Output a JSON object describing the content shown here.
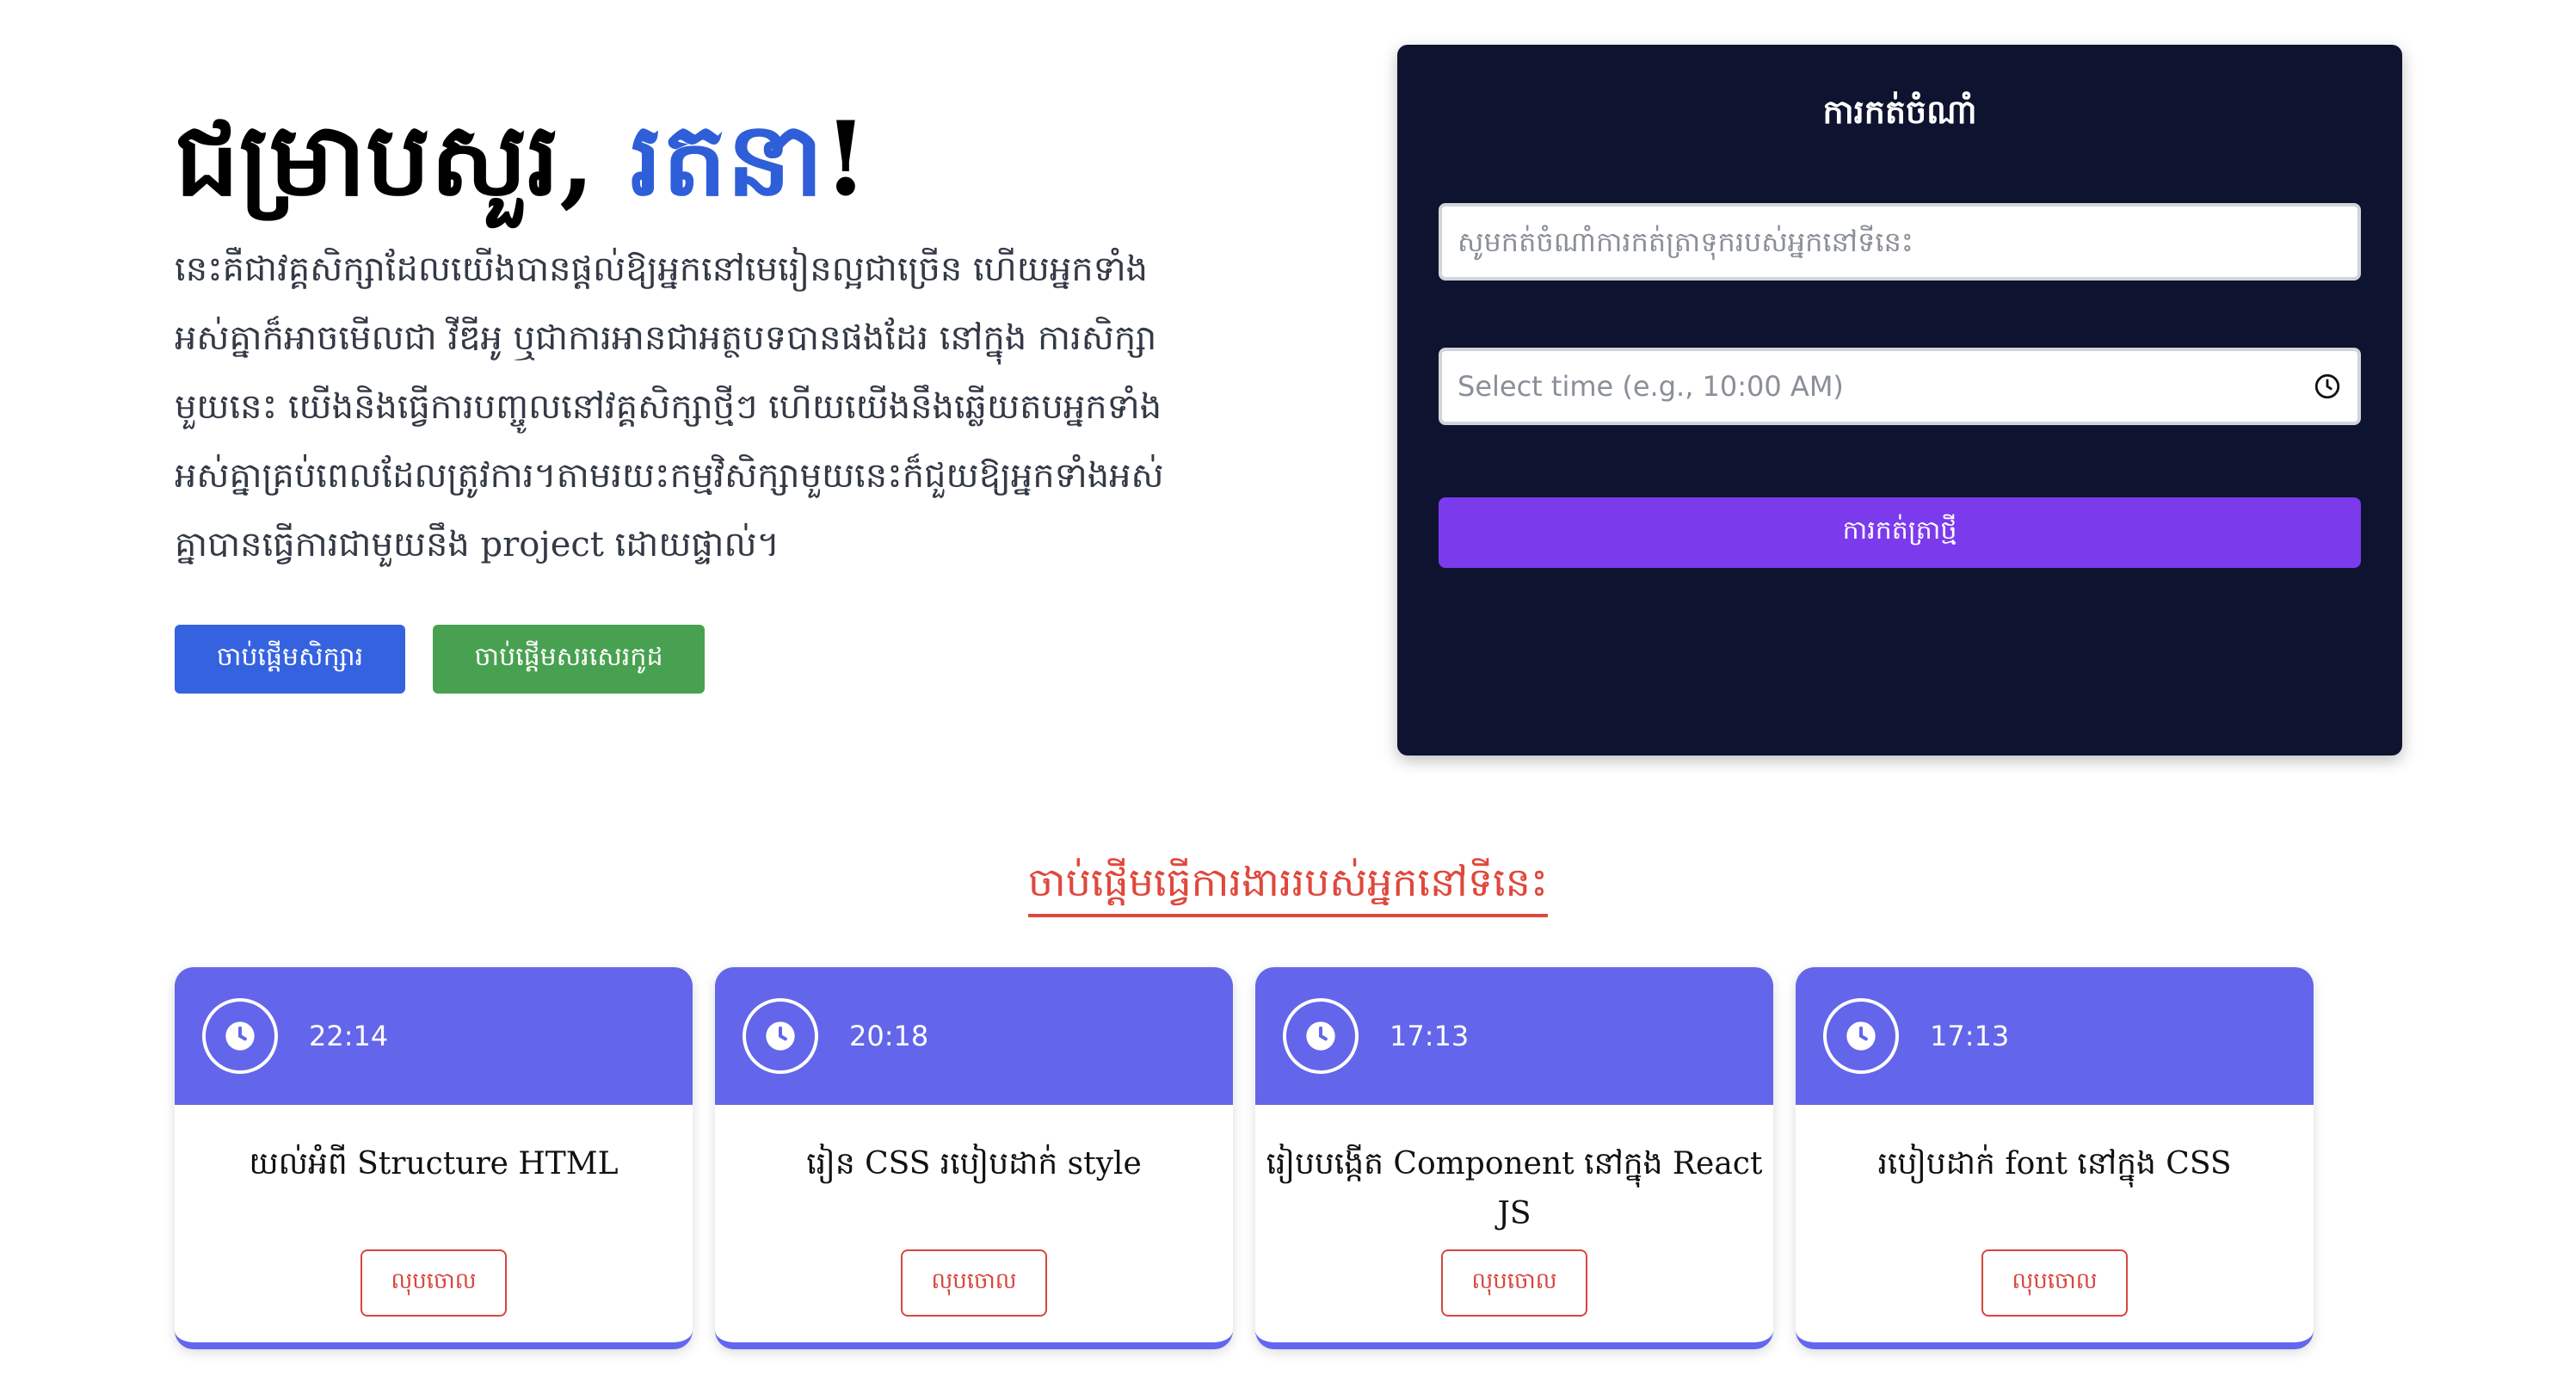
{
  "hero": {
    "greeting": "ជម្រាបសួរ, ",
    "name": "រតនា",
    "exclaim": "!",
    "description": "នេះគឺជាវគ្គសិក្សាដែលយើងបានផ្តល់ឱ្យអ្នកនៅមេរៀនល្អជាច្រើន ហើយអ្នកទាំងអស់គ្នាក៏អាចមើលជា វីឌីអូ ឬជាការអានជាអត្ថបទបានផងដែរ នៅក្នុង ការសិក្សាមួយនេះ យើងនិងធ្វើការបញ្ចូលនៅវគ្គសិក្សាថ្មីៗ ហើយយើងនឹងឆ្លើយតបអ្នកទាំងអស់គ្នាគ្រប់ពេលដែលត្រូវការ។តាមរយះកម្មវិសិក្សាមួយនេះក៏ជួយឱ្យអ្នកទាំងអស់គ្នាបានធ្វើការជាមួយនឹង project ដោយផ្ទាល់។",
    "start_learning_label": "ចាប់ផ្តើមសិក្សារ",
    "start_coding_label": "ចាប់ផ្តើមសរសេរកូដ"
  },
  "panel": {
    "title": "ការកត់ចំណាំ",
    "task_placeholder": "សូមកត់ចំណាំការកត់ត្រាទុករបស់អ្នកនៅទីនេះ",
    "time_placeholder": "Select time (e.g., 10:00 AM)",
    "submit_label": "ការកត់ត្រាថ្មី"
  },
  "section_title": "ចាប់ផ្តើមធ្វើការងាររបស់អ្នកនៅទីនេះ",
  "colors": {
    "accent_blue": "#3563e0",
    "accent_green": "#48a150",
    "panel_bg": "#0e1330",
    "submit_purple": "#7c3aed",
    "card_header": "#6366ea",
    "danger": "#d7473e"
  },
  "cards": [
    {
      "time": "22:14",
      "text": "យល់អំពី Structure HTML",
      "delete_label": "លុបចោល",
      "icon": "clock-icon"
    },
    {
      "time": "20:18",
      "text": "រៀន CSS របៀបដាក់ style",
      "delete_label": "លុបចោល",
      "icon": "clock-icon"
    },
    {
      "time": "17:13",
      "text": "រៀបបង្កើត Component នៅក្នុង React JS",
      "delete_label": "លុបចោល",
      "icon": "clock-icon"
    },
    {
      "time": "17:13",
      "text": "របៀបដាក់ font នៅក្នុង CSS",
      "delete_label": "លុបចោល",
      "icon": "clock-icon"
    }
  ]
}
